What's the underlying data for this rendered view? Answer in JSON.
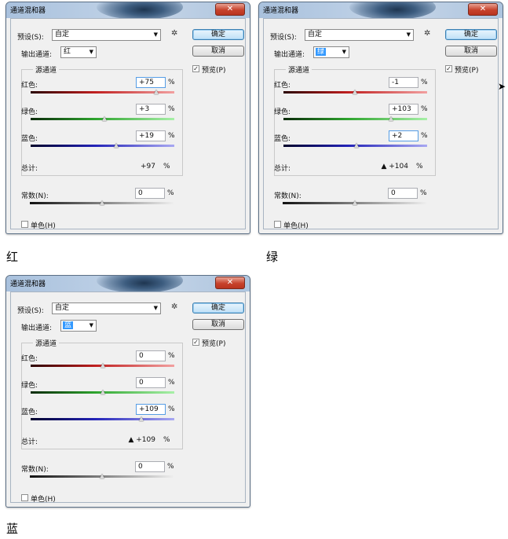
{
  "dialogs": [
    {
      "title": "通道混和器",
      "close": "✕",
      "preset_label": "预设(S):",
      "preset_value": "自定",
      "ok": "确定",
      "cancel": "取消",
      "preview": "预览(P)",
      "preview_checked": "✓",
      "output_label": "输出通道:",
      "output_value": "红",
      "output_highlight": false,
      "source_group": "源通道",
      "red_label": "红色:",
      "red_value": "+75",
      "red_level": 0.875,
      "green_label": "绿色:",
      "green_value": "+3",
      "green_level": 0.515,
      "blue_label": "蓝色:",
      "blue_value": "+19",
      "blue_level": 0.595,
      "total_label": "总计:",
      "total_warn": "",
      "total_value": "+97",
      "const_label": "常数(N):",
      "const_value": "0",
      "const_level": 0.5,
      "mono_label": "单色(H)",
      "percent": "%",
      "focus": "red"
    },
    {
      "title": "通道混和器",
      "close": "✕",
      "preset_label": "预设(S):",
      "preset_value": "自定",
      "ok": "确定",
      "cancel": "取消",
      "preview": "预览(P)",
      "preview_checked": "✓",
      "output_label": "输出通道:",
      "output_value": "绿",
      "output_highlight": true,
      "source_group": "源通道",
      "red_label": "红色:",
      "red_value": "-1",
      "red_level": 0.495,
      "green_label": "绿色:",
      "green_value": "+103",
      "green_level": 0.75,
      "blue_label": "蓝色:",
      "blue_value": "+2",
      "blue_level": 0.51,
      "total_label": "总计:",
      "total_warn": "▲",
      "total_value": "+104",
      "const_label": "常数(N):",
      "const_value": "0",
      "const_level": 0.5,
      "mono_label": "单色(H)",
      "percent": "%",
      "focus": "blue"
    },
    {
      "title": "通道混和器",
      "close": "✕",
      "preset_label": "预设(S):",
      "preset_value": "自定",
      "ok": "确定",
      "cancel": "取消",
      "preview": "预览(P)",
      "preview_checked": "✓",
      "output_label": "输出通道:",
      "output_value": "蓝",
      "output_highlight": true,
      "source_group": "源通道",
      "red_label": "红色:",
      "red_value": "0",
      "red_level": 0.5,
      "green_label": "绿色:",
      "green_value": "0",
      "green_level": 0.5,
      "blue_label": "蓝色:",
      "blue_value": "+109",
      "blue_level": 0.77,
      "total_label": "总计:",
      "total_warn": "▲",
      "total_value": "+109",
      "const_label": "常数(N):",
      "const_value": "0",
      "const_level": 0.5,
      "mono_label": "单色(H)",
      "percent": "%",
      "focus": "blue"
    }
  ],
  "captions": [
    "红",
    "绿",
    "蓝"
  ],
  "cursor_icon": "arrow-cursor-icon"
}
